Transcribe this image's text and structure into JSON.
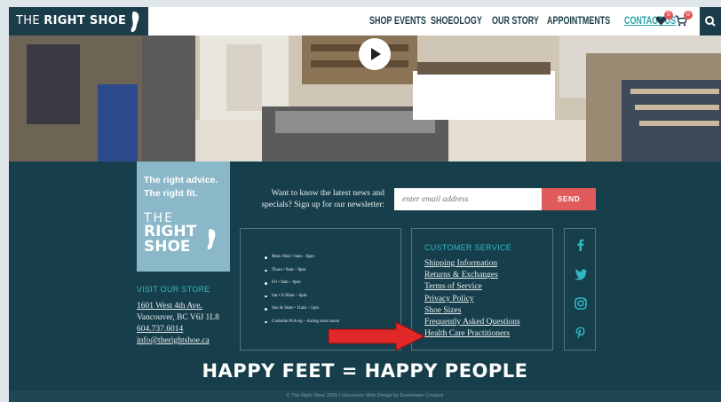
{
  "header": {
    "logo_prefix": "THE ",
    "logo_bold": "RIGHT SHOE",
    "menu": [
      "SHOP",
      "EVENTS",
      "SHOEOLOGY",
      "OUR STORY",
      "APPOINTMENTS",
      "CONTACT US"
    ],
    "wishlist_count": "0",
    "cart_count": "0"
  },
  "hero": {
    "play_icon": "play-icon"
  },
  "footer": {
    "tagline_line1": "The right advice.",
    "tagline_line2": "The right fit.",
    "brand_line1": "THE",
    "brand_line2": "RIGHT",
    "brand_line3": "SHOE",
    "visit_title": "VISIT OUR STORE",
    "address_line1": "1601 West 4th Ave.",
    "address_line2": "Vancouver, BC V6J 1L8",
    "phone": "604.737.6014",
    "email": "info@therightshoe.ca",
    "newsletter_text": "Want to know the latest news and specials? Sign up for our newsletter:",
    "newsletter_placeholder": "enter email address",
    "send_label": "SEND",
    "hours": [
      "Mon–Wed • 9am – 6pm",
      "Thurs • 9am – 8pm",
      "Fri • 9am – 6pm",
      "Sat • 9:30am – 6pm",
      "Sun & Stats • 11am – 5pm",
      "Curbside Pick-up – during store hours"
    ],
    "customer_service_title": "CUSTOMER SERVICE",
    "customer_service_links": [
      "Shipping Information",
      "Returns & Exchanges",
      "Terms of Service",
      "Privacy Policy",
      "Shoe Sizes",
      "Frequently Asked Questions",
      "Health Care Practitioners"
    ],
    "social": [
      "facebook-icon",
      "twitter-icon",
      "instagram-icon",
      "pinterest-icon"
    ],
    "slogan": "HAPPY FEET = HAPPY PEOPLE",
    "copyright": "© The Right Shoe 2025  |  Vancouver Web Design by Everbeater Creative"
  },
  "colors": {
    "footer_bg": "#173f4b",
    "accent_teal": "#2fb8c0",
    "send_red": "#e05b5b",
    "arrow_red": "#e02828",
    "tag_blue": "#8ab8c8"
  }
}
